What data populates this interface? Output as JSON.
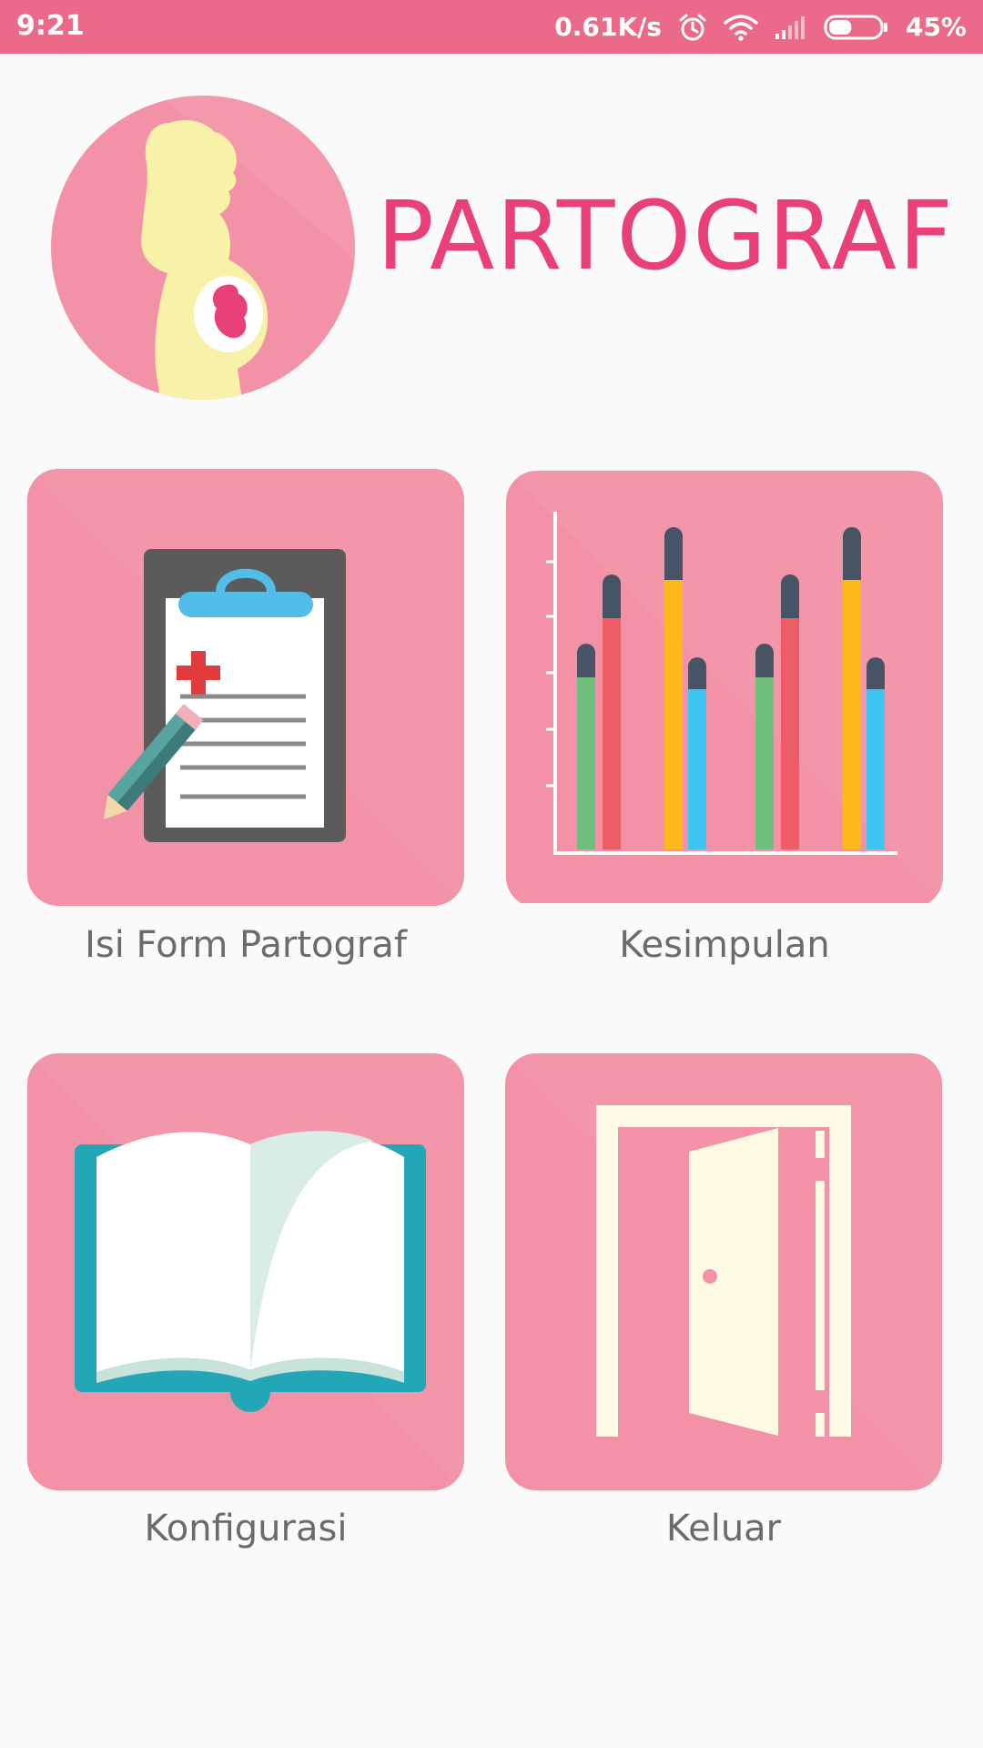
{
  "status_bar": {
    "time": "9:21",
    "network_speed": "0.61K/s",
    "battery": "45%",
    "battery_level": 0.45,
    "icons": [
      "alarm-icon",
      "wifi-icon",
      "signal-icon",
      "battery-icon"
    ],
    "background": "#ec6a89"
  },
  "header": {
    "title": "PARTOGRAF",
    "title_color": "#ea407a",
    "logo_icon": "pregnant-woman-icon"
  },
  "menu": {
    "items": [
      {
        "label": "Isi Form Partograf",
        "icon": "clipboard-icon"
      },
      {
        "label": "Kesimpulan",
        "icon": "bar-chart-icon"
      },
      {
        "label": "Konfigurasi",
        "icon": "open-book-icon"
      },
      {
        "label": "Keluar",
        "icon": "door-icon"
      }
    ],
    "tile_color": "#f392a6"
  }
}
